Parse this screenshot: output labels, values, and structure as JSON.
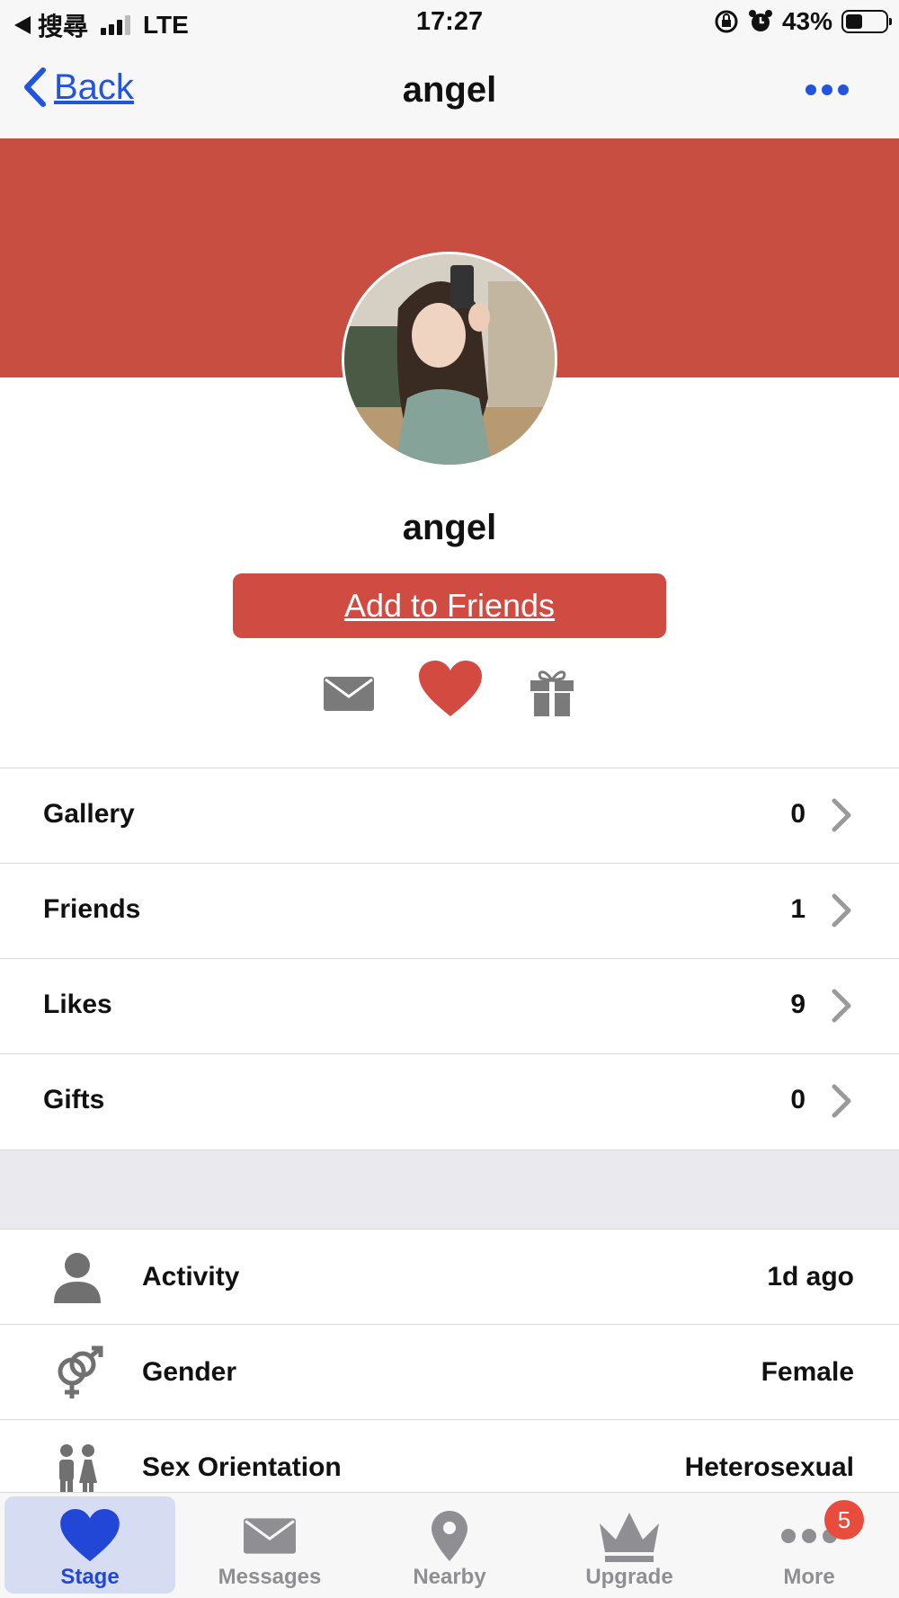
{
  "status_bar": {
    "carrier": "搜尋",
    "network": "LTE",
    "time": "17:27",
    "battery": "43%",
    "battery_level": 0.43
  },
  "nav": {
    "back_label": "Back",
    "title": "angel"
  },
  "profile": {
    "name": "angel",
    "add_friends_label": "Add to Friends",
    "actions": [
      "mail-icon",
      "heart-icon",
      "gift-icon"
    ]
  },
  "stats": [
    {
      "label": "Gallery",
      "value": "0"
    },
    {
      "label": "Friends",
      "value": "1"
    },
    {
      "label": "Likes",
      "value": "9"
    },
    {
      "label": "Gifts",
      "value": "0"
    }
  ],
  "info": [
    {
      "icon": "person-icon",
      "label": "Activity",
      "value": "1d ago"
    },
    {
      "icon": "gender-icon",
      "label": "Gender",
      "value": "Female"
    },
    {
      "icon": "couple-icon",
      "label": "Sex Orientation",
      "value": "Heterosexual"
    }
  ],
  "tabs": [
    {
      "icon": "heart-icon",
      "label": "Stage",
      "active": true
    },
    {
      "icon": "mail-icon",
      "label": "Messages"
    },
    {
      "icon": "location-pin-icon",
      "label": "Nearby"
    },
    {
      "icon": "crown-icon",
      "label": "Upgrade"
    },
    {
      "icon": "dots-icon",
      "label": "More",
      "badge": "5"
    }
  ],
  "colors": {
    "accent": "#2255dd",
    "banner": "#c84e42",
    "button": "#d04b41",
    "heart": "#d34a40",
    "badge": "#e84c3d"
  }
}
